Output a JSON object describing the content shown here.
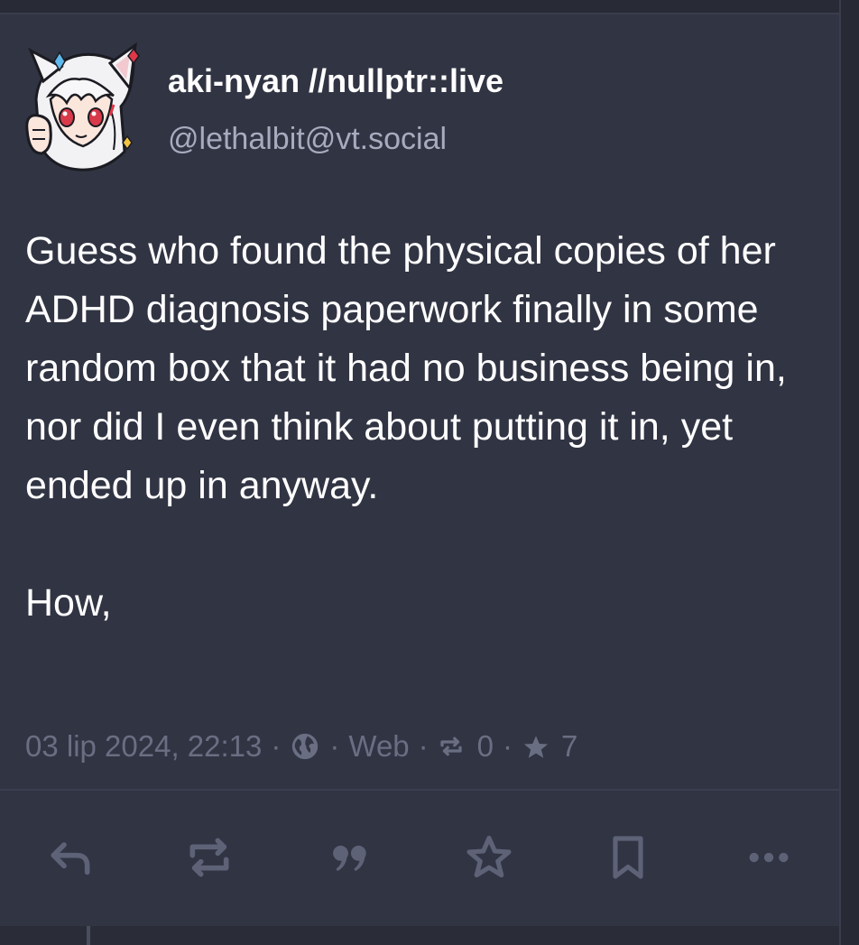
{
  "post": {
    "author": {
      "display_name": "aki-nyan //nullptr::live",
      "handle": "@lethalbit@vt.social",
      "avatar_icon": "anime-catgirl-avatar"
    },
    "content": {
      "paragraph_1": "Guess who found the physical copies of her ADHD diagnosis paperwork finally in some random box that it had no business being in, nor did I even think about putting it in, yet ended up in anyway.",
      "paragraph_2": "How,"
    },
    "meta": {
      "timestamp": "03 lip 2024, 22:13",
      "separator": "·",
      "visibility_icon": "globe-icon",
      "application": "Web",
      "boost_icon": "boost-icon",
      "boosts": "0",
      "favourite_icon": "star-icon",
      "favourites": "7"
    },
    "actions": [
      {
        "icon": "reply-icon"
      },
      {
        "icon": "boost-icon"
      },
      {
        "icon": "quote-icon"
      },
      {
        "icon": "star-icon"
      },
      {
        "icon": "bookmark-icon"
      },
      {
        "icon": "more-icon"
      }
    ]
  },
  "colors": {
    "background": "#2a2c38",
    "card": "#313443",
    "text": "#ffffff",
    "handle": "#a8abbe",
    "meta": "#6a6e82",
    "icon": "#5e6277"
  }
}
